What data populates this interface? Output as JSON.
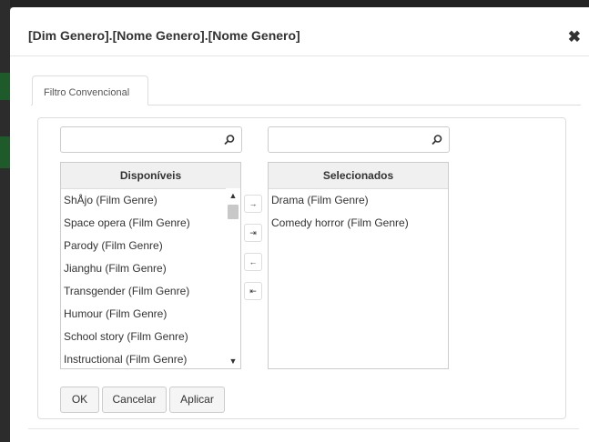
{
  "dialog": {
    "title": "[Dim Genero].[Nome Genero].[Nome Genero]",
    "close_icon": "close-icon"
  },
  "tabs": [
    {
      "label": "Filtro Convencional",
      "active": true
    }
  ],
  "search_left": {
    "value": "",
    "placeholder": "",
    "icon": "search-icon"
  },
  "search_right": {
    "value": "",
    "placeholder": "",
    "icon": "search-icon"
  },
  "available": {
    "header": "Disponíveis",
    "items": [
      "ShÅjo (Film Genre)",
      "Space opera (Film Genre)",
      "Parody (Film Genre)",
      "Jianghu (Film Genre)",
      "Transgender (Film Genre)",
      "Humour (Film Genre)",
      "School story (Film Genre)",
      "Instructional (Film Genre)"
    ]
  },
  "selected": {
    "header": "Selecionados",
    "items": [
      "Drama (Film Genre)",
      "Comedy horror (Film Genre)"
    ]
  },
  "move_buttons": {
    "add": "→",
    "add_all": "⇥",
    "remove": "←",
    "remove_all": "⇤"
  },
  "actions": {
    "ok": "OK",
    "cancel": "Cancelar",
    "apply": "Aplicar"
  },
  "colors": {
    "header_bg": "#f0f0f0",
    "border": "#cccccc"
  }
}
